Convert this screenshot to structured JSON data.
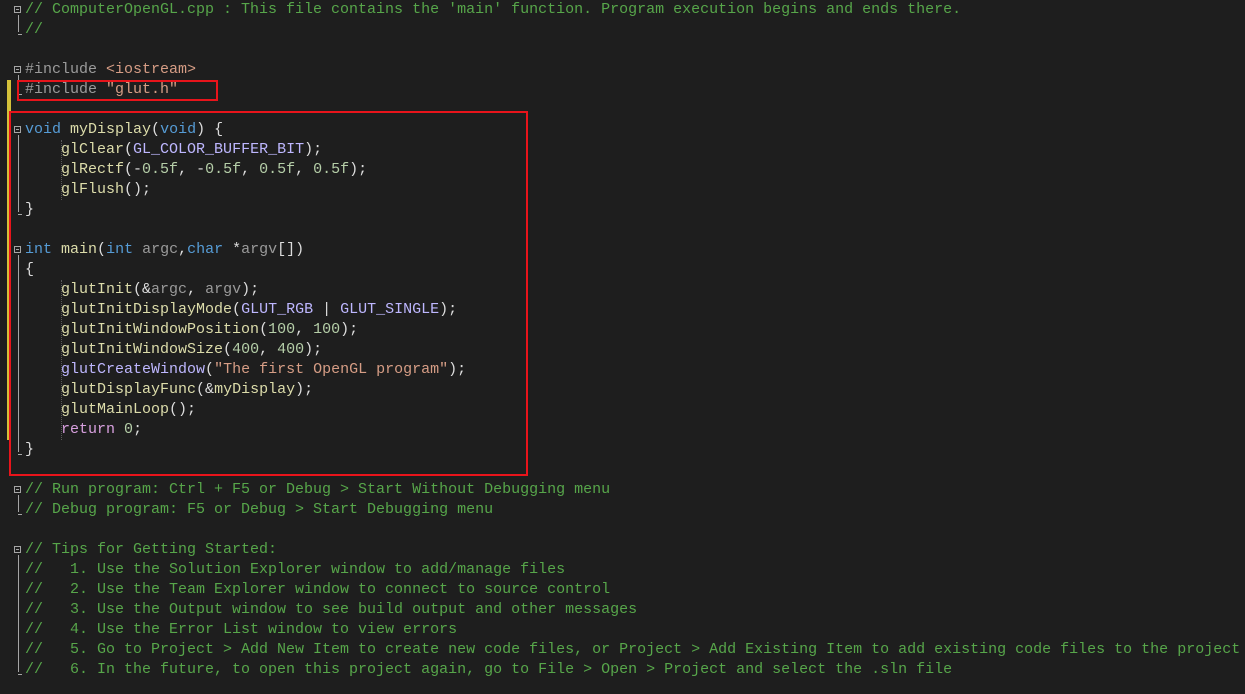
{
  "editor": {
    "colors": {
      "background": "#1e1e1e",
      "comment": "#57a64a",
      "preprocessor": "#9b9b9b",
      "string": "#d69d85",
      "keyword": "#569cd6",
      "function": "#dcdcaa",
      "macro": "#beb7ff",
      "number": "#b5cea8",
      "control": "#d8a0df",
      "highlight_box": "#e8141b",
      "change_bar": "#d4c13a"
    },
    "lines": [
      {
        "fold": true,
        "tokens": [
          [
            "cm",
            "// ComputerOpenGL.cpp : This file contains the 'main' function. Program execution begins and ends there."
          ]
        ]
      },
      {
        "tokens": [
          [
            "cm",
            "//"
          ]
        ]
      },
      {
        "tokens": []
      },
      {
        "fold": true,
        "tokens": [
          [
            "pp",
            "#include "
          ],
          [
            "st",
            "<iostream>"
          ]
        ]
      },
      {
        "tokens": [
          [
            "pp",
            "#include "
          ],
          [
            "st",
            "\"glut.h\""
          ]
        ]
      },
      {
        "tokens": []
      },
      {
        "fold": true,
        "tokens": [
          [
            "kw",
            "void"
          ],
          [
            "pl",
            " "
          ],
          [
            "fn",
            "myDisplay"
          ],
          [
            "pl",
            "("
          ],
          [
            "kw",
            "void"
          ],
          [
            "pl",
            ") {"
          ]
        ]
      },
      {
        "tokens": [
          [
            "pl",
            "    "
          ],
          [
            "fn",
            "glClear"
          ],
          [
            "pl",
            "("
          ],
          [
            "mc",
            "GL_COLOR_BUFFER_BIT"
          ],
          [
            "pl",
            ");"
          ]
        ]
      },
      {
        "tokens": [
          [
            "pl",
            "    "
          ],
          [
            "fn",
            "glRectf"
          ],
          [
            "pl",
            "(-"
          ],
          [
            "nu",
            "0.5f"
          ],
          [
            "pl",
            ", -"
          ],
          [
            "nu",
            "0.5f"
          ],
          [
            "pl",
            ", "
          ],
          [
            "nu",
            "0.5f"
          ],
          [
            "pl",
            ", "
          ],
          [
            "nu",
            "0.5f"
          ],
          [
            "pl",
            ");"
          ]
        ]
      },
      {
        "tokens": [
          [
            "pl",
            "    "
          ],
          [
            "fn",
            "glFlush"
          ],
          [
            "pl",
            "();"
          ]
        ]
      },
      {
        "tokens": [
          [
            "pl",
            "}"
          ]
        ]
      },
      {
        "tokens": []
      },
      {
        "fold": true,
        "tokens": [
          [
            "kw",
            "int"
          ],
          [
            "pl",
            " "
          ],
          [
            "fn",
            "main"
          ],
          [
            "pl",
            "("
          ],
          [
            "kw",
            "int"
          ],
          [
            "pl",
            " "
          ],
          [
            "pa",
            "argc"
          ],
          [
            "pl",
            ","
          ],
          [
            "kw",
            "char"
          ],
          [
            "pl",
            " *"
          ],
          [
            "pa",
            "argv"
          ],
          [
            "pl",
            "[])"
          ]
        ]
      },
      {
        "tokens": [
          [
            "pl",
            "{"
          ]
        ]
      },
      {
        "tokens": [
          [
            "pl",
            "    "
          ],
          [
            "fn",
            "glutInit"
          ],
          [
            "pl",
            "(&"
          ],
          [
            "pa",
            "argc"
          ],
          [
            "pl",
            ", "
          ],
          [
            "pa",
            "argv"
          ],
          [
            "pl",
            ");"
          ]
        ]
      },
      {
        "tokens": [
          [
            "pl",
            "    "
          ],
          [
            "fn",
            "glutInitDisplayMode"
          ],
          [
            "pl",
            "("
          ],
          [
            "mc",
            "GLUT_RGB"
          ],
          [
            "pl",
            " | "
          ],
          [
            "mc",
            "GLUT_SINGLE"
          ],
          [
            "pl",
            ");"
          ]
        ]
      },
      {
        "tokens": [
          [
            "pl",
            "    "
          ],
          [
            "fn",
            "glutInitWindowPosition"
          ],
          [
            "pl",
            "("
          ],
          [
            "nu",
            "100"
          ],
          [
            "pl",
            ", "
          ],
          [
            "nu",
            "100"
          ],
          [
            "pl",
            ");"
          ]
        ]
      },
      {
        "tokens": [
          [
            "pl",
            "    "
          ],
          [
            "fn",
            "glutInitWindowSize"
          ],
          [
            "pl",
            "("
          ],
          [
            "nu",
            "400"
          ],
          [
            "pl",
            ", "
          ],
          [
            "nu",
            "400"
          ],
          [
            "pl",
            ");"
          ]
        ]
      },
      {
        "tokens": [
          [
            "pl",
            "    "
          ],
          [
            "mc",
            "glutCreateWindow"
          ],
          [
            "pl",
            "("
          ],
          [
            "st",
            "\"The first OpenGL program\""
          ],
          [
            "pl",
            ");"
          ]
        ]
      },
      {
        "tokens": [
          [
            "pl",
            "    "
          ],
          [
            "fn",
            "glutDisplayFunc"
          ],
          [
            "pl",
            "(&"
          ],
          [
            "fn",
            "myDisplay"
          ],
          [
            "pl",
            ");"
          ]
        ]
      },
      {
        "tokens": [
          [
            "pl",
            "    "
          ],
          [
            "fn",
            "glutMainLoop"
          ],
          [
            "pl",
            "();"
          ]
        ]
      },
      {
        "tokens": [
          [
            "pl",
            "    "
          ],
          [
            "ct",
            "return"
          ],
          [
            "pl",
            " "
          ],
          [
            "nu",
            "0"
          ],
          [
            "pl",
            ";"
          ]
        ]
      },
      {
        "tokens": [
          [
            "pl",
            "}"
          ]
        ]
      },
      {
        "tokens": []
      },
      {
        "fold": true,
        "tokens": [
          [
            "cm",
            "// Run program: Ctrl + F5 or Debug > Start Without Debugging menu"
          ]
        ]
      },
      {
        "tokens": [
          [
            "cm",
            "// Debug program: F5 or Debug > Start Debugging menu"
          ]
        ]
      },
      {
        "tokens": []
      },
      {
        "fold": true,
        "tokens": [
          [
            "cm",
            "// Tips for Getting Started:"
          ]
        ]
      },
      {
        "tokens": [
          [
            "cm",
            "//   1. Use the Solution Explorer window to add/manage files"
          ]
        ]
      },
      {
        "tokens": [
          [
            "cm",
            "//   2. Use the Team Explorer window to connect to source control"
          ]
        ]
      },
      {
        "tokens": [
          [
            "cm",
            "//   3. Use the Output window to see build output and other messages"
          ]
        ]
      },
      {
        "tokens": [
          [
            "cm",
            "//   4. Use the Error List window to view errors"
          ]
        ]
      },
      {
        "tokens": [
          [
            "cm",
            "//   5. Go to Project > Add New Item to create new code files, or Project > Add Existing Item to add existing code files to the project"
          ]
        ]
      },
      {
        "tokens": [
          [
            "cm",
            "//   6. In the future, to open this project again, go to File > Open > Project and select the .sln file"
          ]
        ]
      }
    ]
  }
}
